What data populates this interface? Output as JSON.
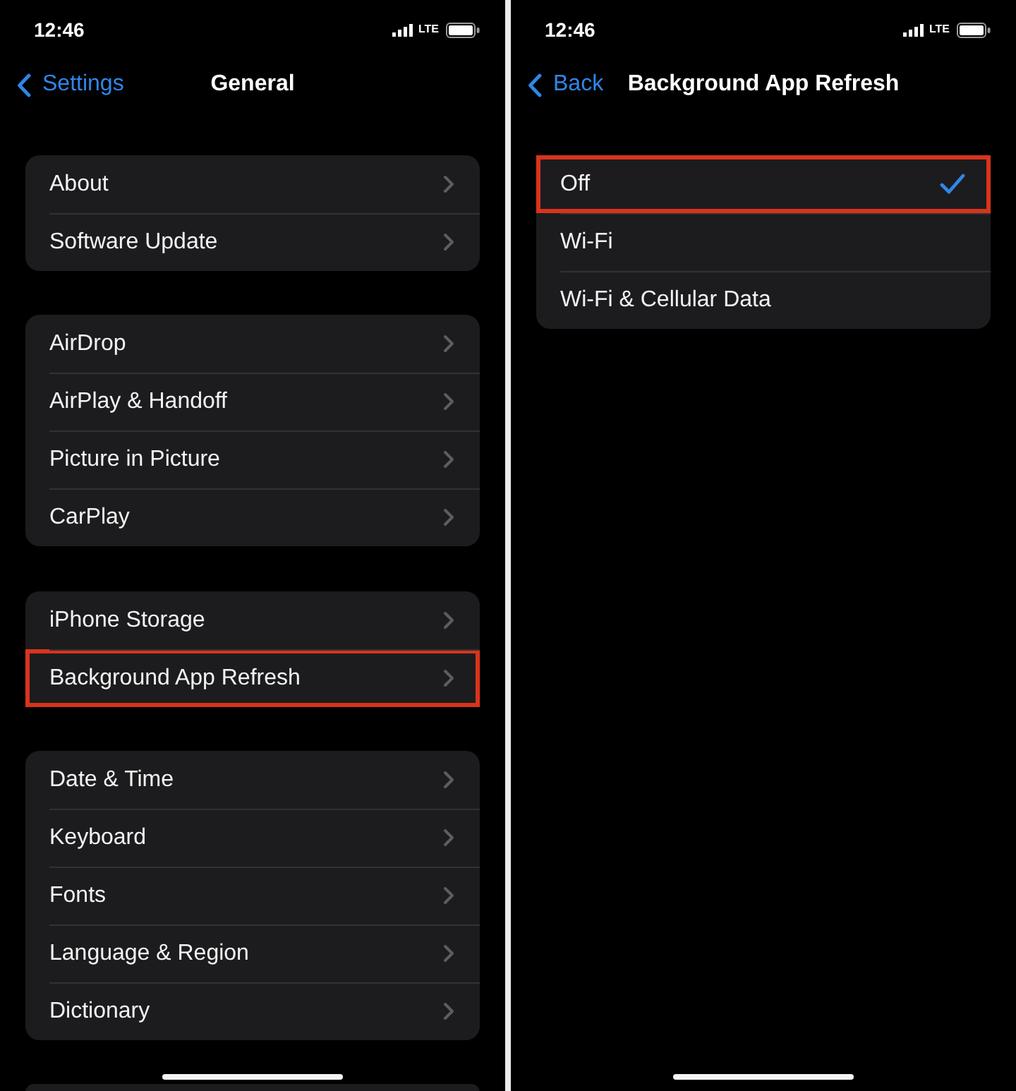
{
  "panels": [
    {
      "status_bar": {
        "time": "12:46",
        "network": "LTE"
      },
      "nav": {
        "back_label": "Settings",
        "title": "General"
      },
      "groups_continue_below": true,
      "groups": [
        {
          "rows": [
            {
              "kind": "disclosure",
              "label": "About",
              "highlighted": false
            },
            {
              "kind": "disclosure",
              "label": "Software Update",
              "highlighted": false
            }
          ]
        },
        {
          "rows": [
            {
              "kind": "disclosure",
              "label": "AirDrop",
              "highlighted": false
            },
            {
              "kind": "disclosure",
              "label": "AirPlay & Handoff",
              "highlighted": false
            },
            {
              "kind": "disclosure",
              "label": "Picture in Picture",
              "highlighted": false
            },
            {
              "kind": "disclosure",
              "label": "CarPlay",
              "highlighted": false
            }
          ]
        },
        {
          "rows": [
            {
              "kind": "disclosure",
              "label": "iPhone Storage",
              "highlighted": false
            },
            {
              "kind": "disclosure",
              "label": "Background App Refresh",
              "highlighted": true
            }
          ]
        },
        {
          "rows": [
            {
              "kind": "disclosure",
              "label": "Date & Time",
              "highlighted": false
            },
            {
              "kind": "disclosure",
              "label": "Keyboard",
              "highlighted": false
            },
            {
              "kind": "disclosure",
              "label": "Fonts",
              "highlighted": false
            },
            {
              "kind": "disclosure",
              "label": "Language & Region",
              "highlighted": false
            },
            {
              "kind": "disclosure",
              "label": "Dictionary",
              "highlighted": false
            }
          ]
        }
      ]
    },
    {
      "status_bar": {
        "time": "12:46",
        "network": "LTE"
      },
      "nav": {
        "back_label": "Back",
        "title": "Background App Refresh"
      },
      "groups": [
        {
          "rows": [
            {
              "kind": "choice",
              "label": "Off",
              "selected": true,
              "highlighted": true
            },
            {
              "kind": "choice",
              "label": "Wi-Fi",
              "selected": false,
              "highlighted": false
            },
            {
              "kind": "choice",
              "label": "Wi-Fi & Cellular Data",
              "selected": false,
              "highlighted": false
            }
          ]
        }
      ]
    }
  ]
}
